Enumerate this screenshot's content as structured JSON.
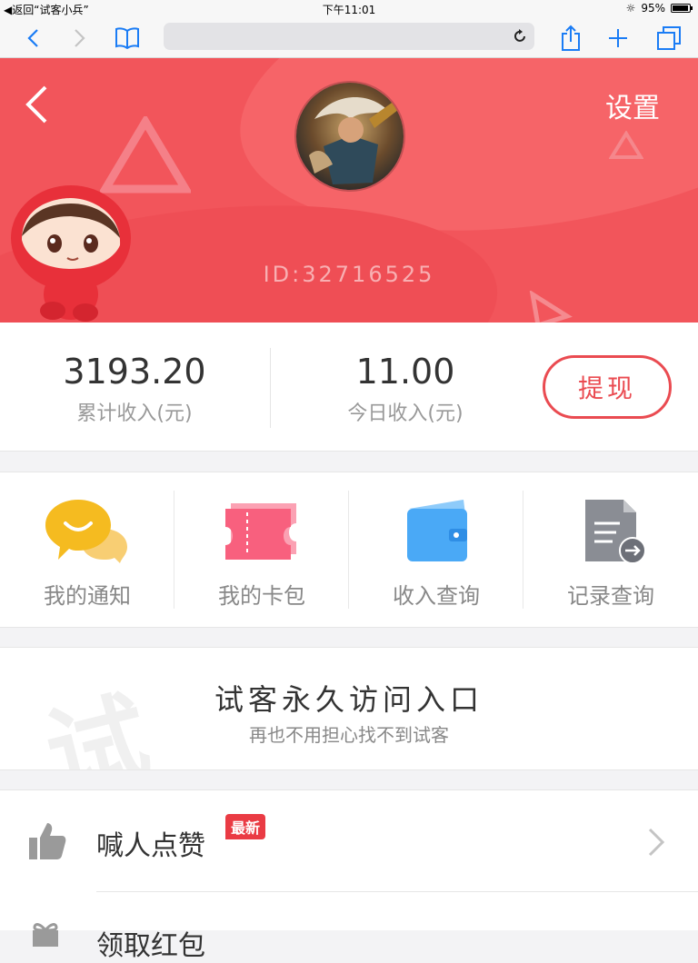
{
  "status_bar": {
    "back_app": "◀返回“试客小兵”",
    "time": "下午11:01",
    "battery_percent": "95%",
    "battery_level": 0.95
  },
  "browser": {
    "url": ""
  },
  "header": {
    "settings_label": "设置",
    "user_id": "ID:32716525",
    "colors": {
      "primary": "#f2555b"
    }
  },
  "income": {
    "total": {
      "value": "3193.20",
      "label": "累计收入(元)"
    },
    "today": {
      "value": "11.00",
      "label": "今日收入(元)"
    },
    "withdraw_label": "提现"
  },
  "shortcuts": [
    {
      "label": "我的通知",
      "icon": "chat-bubble-icon"
    },
    {
      "label": "我的卡包",
      "icon": "ticket-icon"
    },
    {
      "label": "收入查询",
      "icon": "wallet-icon"
    },
    {
      "label": "记录查询",
      "icon": "document-arrow-icon"
    }
  ],
  "promo": {
    "watermark": "试",
    "title": "试客永久访问入口",
    "subtitle": "再也不用担心找不到试客"
  },
  "list": [
    {
      "label": "喊人点赞",
      "badge": "最新",
      "icon": "thumbs-up-icon"
    },
    {
      "label": "领取红包",
      "icon": "gift-icon"
    }
  ]
}
